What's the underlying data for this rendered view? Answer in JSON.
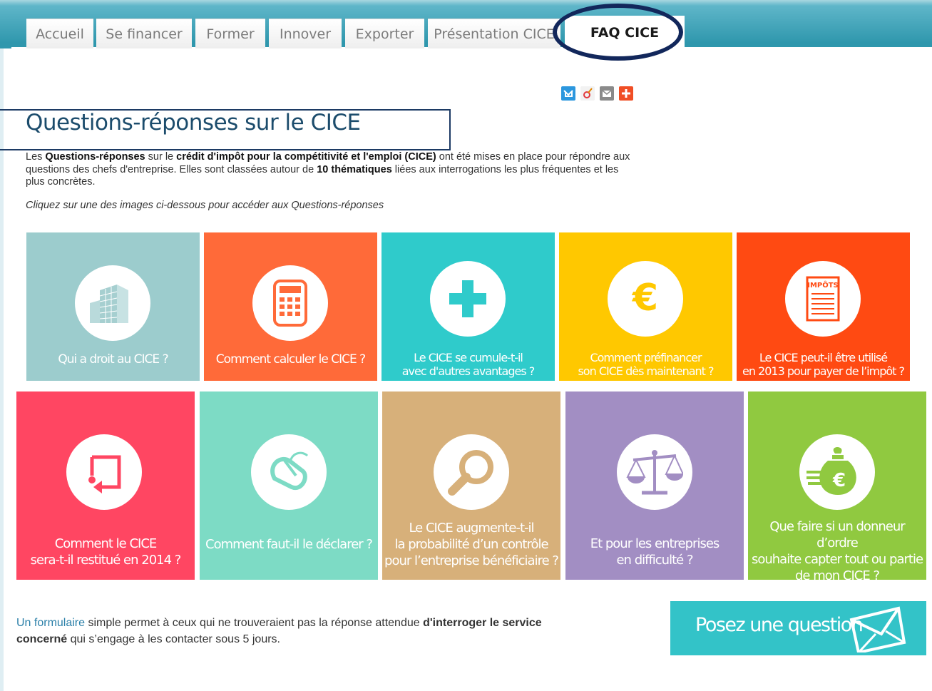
{
  "nav": {
    "tabs": [
      {
        "label": "Accueil"
      },
      {
        "label": "Se financer"
      },
      {
        "label": "Former"
      },
      {
        "label": "Innover"
      },
      {
        "label": "Exporter"
      },
      {
        "label": "Présentation CICE"
      },
      {
        "label": "FAQ CICE",
        "active": true
      }
    ]
  },
  "share": {
    "icons": [
      "twitter-icon",
      "viadeo-icon",
      "email-icon",
      "addthis-icon"
    ]
  },
  "page": {
    "title": "Questions-réponses sur le CICE",
    "intro": {
      "p1": "Les ",
      "b1": "Questions-réponses",
      "p2": " sur le ",
      "b2": "crédit d'impôt pour la compétitivité et l'emploi (CICE)",
      "p3": " ont été mises en place pour répondre aux questions des chefs d'entreprise. Elles sont classées autour de ",
      "b3": "10 thématiques",
      "p4": " liées aux interrogations les plus fréquentes et les plus concrètes."
    },
    "hint": "Cliquez sur une des images ci-dessous pour accéder aux Questions-réponses"
  },
  "tiles": [
    {
      "label": "Qui a droit au CICE ?",
      "icon": "building-icon",
      "color": "#9ccccd"
    },
    {
      "label": "Comment calculer le CICE ?",
      "icon": "calculator-icon",
      "color": "#ff6a39"
    },
    {
      "label": "Le CICE se cumule-t-il\navec d'autres avantages ?",
      "icon": "plus-icon",
      "color": "#2fcbcb"
    },
    {
      "label": "Comment préfinancer\nson CICE dès maintenant ?",
      "icon": "euro-icon",
      "color": "#ffc800"
    },
    {
      "label": "Le CICE peut-il être utilisé\nen 2013 pour payer de l’impôt ?",
      "icon": "tax-form-icon",
      "icon_text": "IMPÔTS",
      "color": "#ff4a12"
    },
    {
      "label": "Comment le CICE\nsera-t-il restitué en 2014 ?",
      "icon": "return-arrow-icon",
      "color": "#ff4662"
    },
    {
      "label": "Comment faut-il le déclarer ?",
      "icon": "mouse-icon",
      "color": "#7ddbc5"
    },
    {
      "label": "Le CICE augmente-t-il\nla probabilité d’un contrôle\npour l’entreprise bénéficiaire ?",
      "icon": "magnifier-icon",
      "color": "#d7b07a"
    },
    {
      "label": "Et pour les entreprises\nen difficulté ?",
      "icon": "scales-icon",
      "color": "#a28ec3"
    },
    {
      "label": "Que faire si un donneur d’ordre\nsouhaite capter tout ou partie\nde mon CICE ?",
      "icon": "money-bag-icon",
      "color": "#90c940"
    }
  ],
  "footer": {
    "link": "Un formulaire",
    "t1": " simple permet à ceux qui ne trouveraient pas la réponse attendue ",
    "b1": "d'interroger le service concerné",
    "t2": " qui s’engage à les contacter sous 5 jours."
  },
  "cta": {
    "label": "Posez une question",
    "icon": "envelope-icon"
  },
  "colors": {
    "highlight_oval": "#12275b",
    "title": "#1c4c6c",
    "topbar": "#2f97ad"
  }
}
